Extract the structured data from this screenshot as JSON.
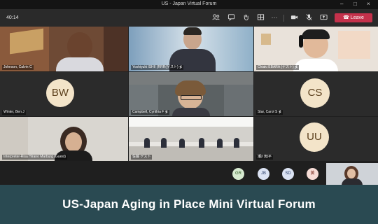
{
  "window": {
    "title": "US - Japan Virtual Forum"
  },
  "toolbar": {
    "clock": "40:14",
    "leave_label": "Leave"
  },
  "tiles": [
    {
      "name": "Johnson, Calvin C"
    },
    {
      "name": "Yoshiyuki ISHII (RRR(ゲスト) ≸"
    },
    {
      "name": "Chiaki EBARA (ゲスト) ≸"
    },
    {
      "name": "Winter, Ben J",
      "initials": "BW"
    },
    {
      "name": "Campbell, Cynthia F ≸"
    },
    {
      "name": "Star, Carol S ≸",
      "initials": "CS"
    },
    {
      "name": "Interpreter-Risa Hirano Marburg (Guest)"
    },
    {
      "name": "佐藤 ゲスト"
    },
    {
      "name": "瀬川知平",
      "initials": "UU"
    }
  ],
  "overflow": [
    {
      "initials": "GR"
    },
    {
      "initials": "JB"
    },
    {
      "initials": "SD"
    },
    {
      "initials": "黄"
    }
  ],
  "banner": {
    "title": "US-Japan Aging in Place Mini Virtual Forum"
  },
  "colors": {
    "avatar_bg": "#f3e4c9",
    "avatar_text": "#5a3e1b",
    "leave": "#c4314b",
    "banner": "#2a4a52"
  }
}
